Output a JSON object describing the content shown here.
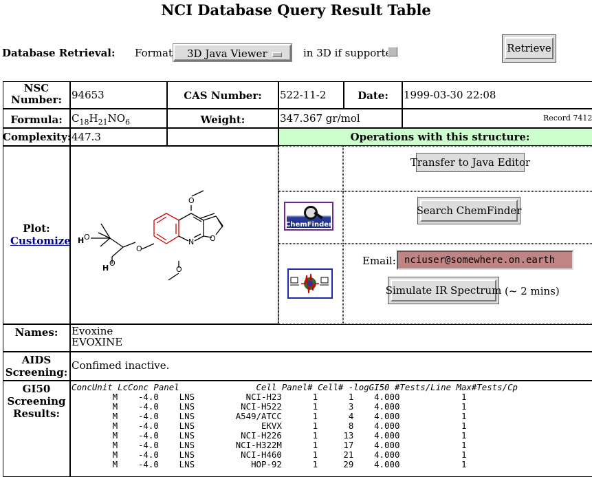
{
  "page": {
    "title": "NCI Database Query Result Table"
  },
  "retrieval": {
    "label": "Database Retrieval:",
    "format_label": "Format:",
    "format_value": "3D Java Viewer",
    "in3d_label": "in 3D if supported",
    "retrieve_button": "Retrieve"
  },
  "info": {
    "nsc_label": "NSC Number:",
    "nsc_value": "94653",
    "cas_label": "CAS Number:",
    "cas_value": "522-11-2",
    "date_label": "Date:",
    "date_value": "1999-03-30 22:08",
    "formula_label": "Formula:",
    "formula_parts": [
      "C",
      "18",
      "H",
      "21",
      "NO",
      "6"
    ],
    "weight_label": "Weight:",
    "weight_value": "347.367 gr/mol",
    "record_text": "Record 7412",
    "complexity_label": "Complexity:",
    "complexity_value": "447.3",
    "ops_header": "Operations with this structure:"
  },
  "plot": {
    "label": "Plot:",
    "customize_link": "Customize",
    "atoms": {
      "O_methoxy_top": "O",
      "O_furan": "O",
      "N": "N",
      "O_methoxy_bottom": "O",
      "O_ether": "O",
      "H1": "H",
      "O_hydroxy1": "O",
      "H2": "H",
      "O_hydroxy2": "O"
    }
  },
  "ops": {
    "transfer_button": "Transfer to Java Editor",
    "chemfinder_logo_text": "ChemFinder",
    "chemfinder_button": "Search ChemFinder",
    "email_label": "Email:",
    "email_value": "nciuser@somewhere.on.earth",
    "ir_button": "Simulate IR Spectrum",
    "ir_note": "(~ 2 mins)"
  },
  "names": {
    "label": "Names:",
    "lines": [
      "Evoxine",
      "EVOXINE"
    ]
  },
  "aids": {
    "label_line1": "AIDS",
    "label_line2": "Screening:",
    "value": "Confimed inactive."
  },
  "gi50": {
    "label_lines": [
      "GI50",
      "Screening",
      "Results:"
    ],
    "columns": [
      "ConcUnit",
      "LcConc",
      "Panel",
      "Cell",
      "Panel#",
      "Cell#",
      "-logGI50",
      "#Tests/Line",
      "Max#Tests/Cp"
    ],
    "rows": [
      [
        "M",
        "-4.0",
        "LNS",
        "NCI-H23",
        "1",
        "1",
        "4.000",
        "1"
      ],
      [
        "M",
        "-4.0",
        "LNS",
        "NCI-H522",
        "1",
        "3",
        "4.000",
        "1"
      ],
      [
        "M",
        "-4.0",
        "LNS",
        "A549/ATCC",
        "1",
        "4",
        "4.000",
        "1"
      ],
      [
        "M",
        "-4.0",
        "LNS",
        "EKVX",
        "1",
        "8",
        "4.000",
        "1"
      ],
      [
        "M",
        "-4.0",
        "LNS",
        "NCI-H226",
        "1",
        "13",
        "4.000",
        "1"
      ],
      [
        "M",
        "-4.0",
        "LNS",
        "NCI-H322M",
        "1",
        "17",
        "4.000",
        "1"
      ],
      [
        "M",
        "-4.0",
        "LNS",
        "NCI-H460",
        "1",
        "21",
        "4.000",
        "1"
      ],
      [
        "M",
        "-4.0",
        "LNS",
        "HOP-92",
        "1",
        "29",
        "4.000",
        "1"
      ]
    ]
  }
}
